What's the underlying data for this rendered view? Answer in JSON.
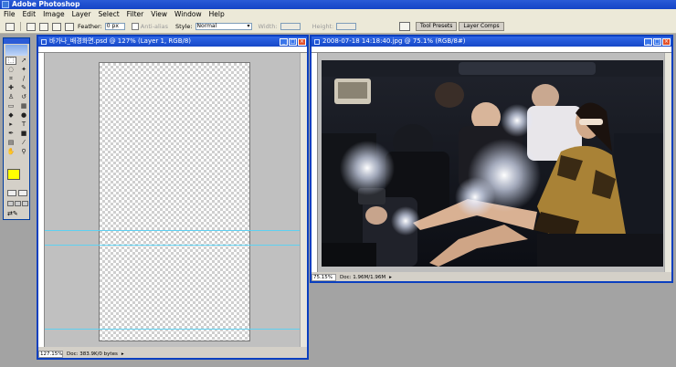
{
  "app": {
    "title": "Adobe Photoshop"
  },
  "menu": [
    "File",
    "Edit",
    "Image",
    "Layer",
    "Select",
    "Filter",
    "View",
    "Window",
    "Help"
  ],
  "options": {
    "feather_label": "Feather:",
    "feather_value": "0 px",
    "antialiased_label": "Anti-alias",
    "style_label": "Style:",
    "style_value": "Normal",
    "width_label": "Width:",
    "height_label": "Height:"
  },
  "palette_well": {
    "tabs": [
      "Tool Presets",
      "Layer Comps"
    ]
  },
  "toolbox": {
    "fg_color": "#ffff00",
    "bg_color": "#ffffff"
  },
  "doc1": {
    "title": "바가나_배경화면.psd @ 127% (Layer 1, RGB/8)",
    "zoom": "127.15%",
    "doc_info": "Doc: 383.9K/0 bytes"
  },
  "doc2": {
    "title": "2008-07-18 14:18:40.jpg @ 75.1% (RGB/8#)",
    "zoom": "75.15%",
    "doc_info": "Doc: 1.96M/1.96M"
  },
  "colors": {
    "title_blue": "#1648c8",
    "window_frame": "#0a3fbf",
    "close_red": "#e2512a",
    "guide_cyan": "#5fd0f0"
  }
}
